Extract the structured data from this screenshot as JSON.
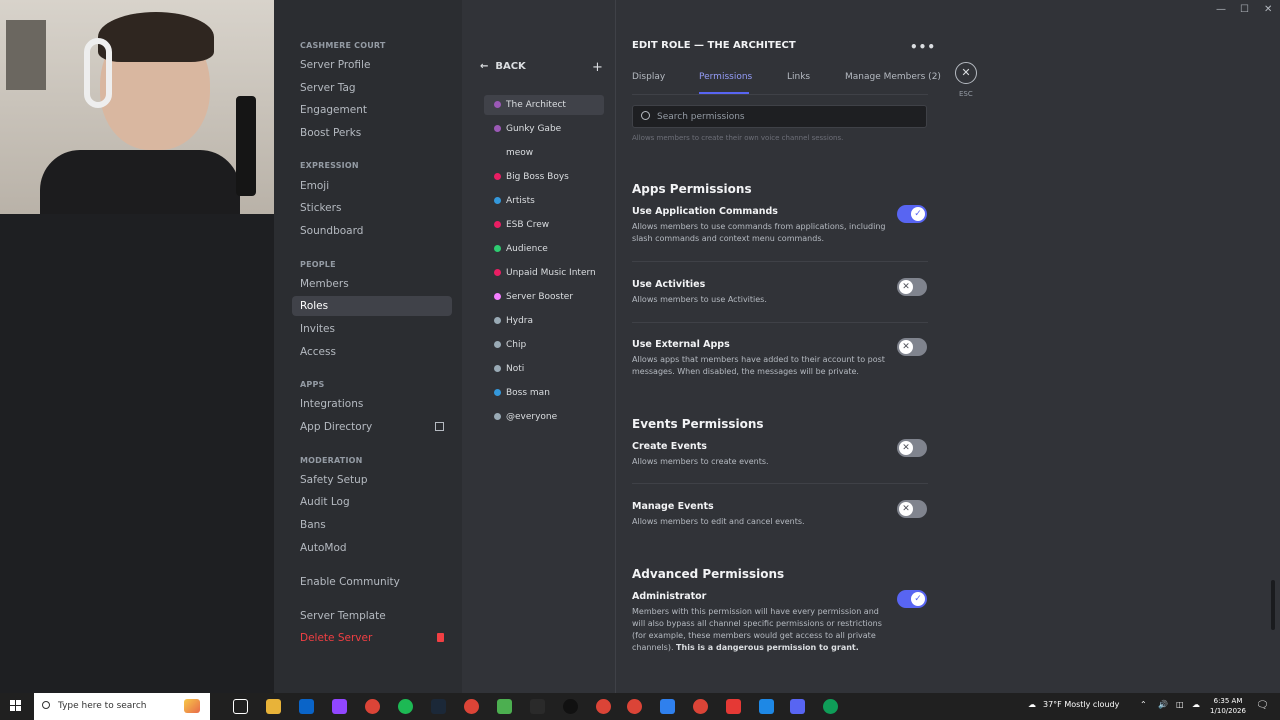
{
  "window": {
    "minimize_glyph": "—",
    "maximize_glyph": "☐",
    "close_glyph": "✕"
  },
  "sidebar": {
    "server_name": "CASHMERE COURT",
    "top_items": [
      "Server Profile",
      "Server Tag",
      "Engagement",
      "Boost Perks"
    ],
    "expression_header": "EXPRESSION",
    "expression_items": [
      "Emoji",
      "Stickers",
      "Soundboard"
    ],
    "people_header": "PEOPLE",
    "people_items": [
      "Members",
      "Roles",
      "Invites",
      "Access"
    ],
    "apps_header": "APPS",
    "apps_items": [
      "Integrations",
      "App Directory"
    ],
    "moderation_header": "MODERATION",
    "moderation_items": [
      "Safety Setup",
      "Audit Log",
      "Bans",
      "AutoMod"
    ],
    "enable_community": "Enable Community",
    "server_template": "Server Template",
    "delete_server": "Delete Server",
    "active_item": "Roles"
  },
  "roles_list": {
    "back_label": "BACK",
    "add_glyph": "+",
    "roles": [
      {
        "name": "The Architect",
        "color": "#9b59b6"
      },
      {
        "name": "Gunky Gabe",
        "color": "#9b59b6"
      },
      {
        "name": "meow",
        "color": ""
      },
      {
        "name": "Big Boss Boys",
        "color": "#e91e63"
      },
      {
        "name": "Artists",
        "color": "#3498db"
      },
      {
        "name": "ESB Crew",
        "color": "#e91e63"
      },
      {
        "name": "Audience",
        "color": "#2ecc71"
      },
      {
        "name": "Unpaid Music Intern",
        "color": "#e91e63"
      },
      {
        "name": "Server Booster",
        "color": "#f47fff"
      },
      {
        "name": "Hydra",
        "color": "#99aab5"
      },
      {
        "name": "Chip",
        "color": "#99aab5"
      },
      {
        "name": "Noti",
        "color": "#99aab5"
      },
      {
        "name": "Boss man",
        "color": "#3498db"
      },
      {
        "name": "@everyone",
        "color": "#99aab5"
      }
    ]
  },
  "editor": {
    "title": "EDIT ROLE — THE ARCHITECT",
    "more_glyph": "•••",
    "tabs": [
      "Display",
      "Permissions",
      "Links",
      "Manage Members (2)"
    ],
    "active_tab": "Permissions",
    "close_glyph": "✕",
    "esc_label": "ESC",
    "search_placeholder": "Search permissions",
    "faded_text": "Allows members to create their own voice channel sessions.",
    "groups": [
      {
        "title": "Apps Permissions",
        "perms": [
          {
            "name": "Use Application Commands",
            "desc": "Allows members to use commands from applications, including slash commands and context menu commands.",
            "enabled": true
          },
          {
            "name": "Use Activities",
            "desc": "Allows members to use Activities.",
            "enabled": false
          },
          {
            "name": "Use External Apps",
            "desc": "Allows apps that members have added to their account to post messages. When disabled, the messages will be private.",
            "enabled": false
          }
        ]
      },
      {
        "title": "Events Permissions",
        "perms": [
          {
            "name": "Create Events",
            "desc": "Allows members to create events.",
            "enabled": false
          },
          {
            "name": "Manage Events",
            "desc": "Allows members to edit and cancel events.",
            "enabled": false
          }
        ]
      },
      {
        "title": "Advanced Permissions",
        "perms": [
          {
            "name": "Administrator",
            "desc": "Members with this permission will have every permission and will also bypass all channel specific permissions or restrictions (for example, these members would get access to all private channels).",
            "desc_bold": "This is a dangerous permission to grant.",
            "enabled": true
          }
        ]
      }
    ],
    "toggle_on_glyph": "✓",
    "toggle_off_glyph": "✕"
  },
  "taskbar": {
    "search_placeholder": "Type here to search",
    "weather": "37°F  Mostly cloudy",
    "time": "6:35 AM",
    "date": "1/10/2026"
  },
  "colors": {
    "accent": "#5865f2",
    "danger": "#f23f43",
    "toggle_off": "#80848e"
  }
}
